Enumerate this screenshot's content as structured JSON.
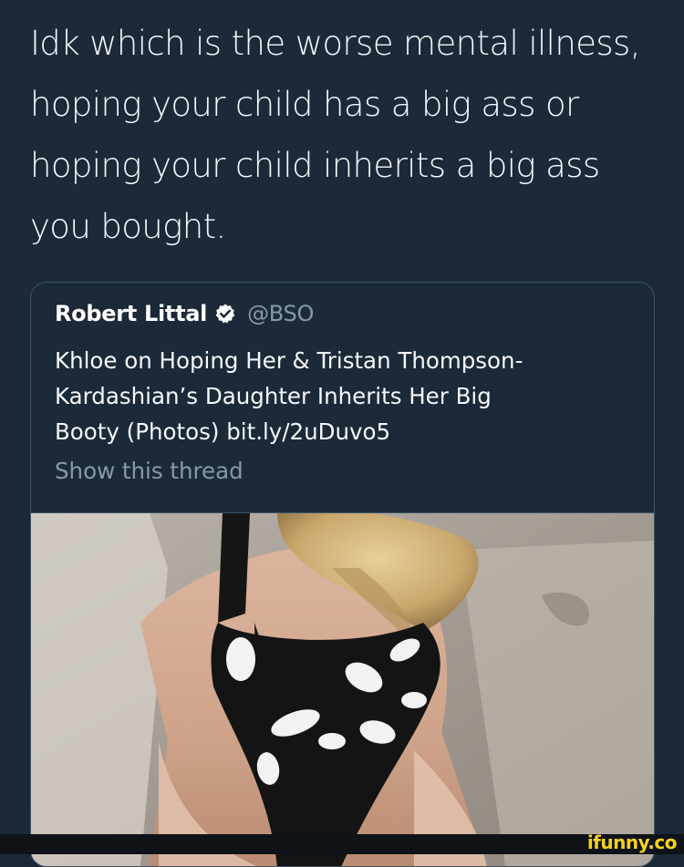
{
  "main_tweet": {
    "lines": [
      "Idk which is the worse mental illness,",
      "hoping your child has a big ass or",
      "hoping your child inherits a big ass",
      "you bought."
    ]
  },
  "quoted_tweet": {
    "author_name": "Robert Littal",
    "verified_icon": "verified-badge-icon",
    "handle": "@BSO",
    "body_lines": [
      "Khloe on Hoping Her & Tristan Thompson-",
      "Kardashian’s Daughter Inherits Her Big",
      "Booty (Photos) bit.ly/2uDuvo5"
    ],
    "show_thread": "Show this thread",
    "media_alt": "photo"
  },
  "watermark": "ifunny.co",
  "colors": {
    "background": "#1c2938",
    "text_primary": "#f5f8fa",
    "text_secondary": "#8899a6",
    "border": "#3d5466",
    "watermark": "#f6d21d"
  }
}
